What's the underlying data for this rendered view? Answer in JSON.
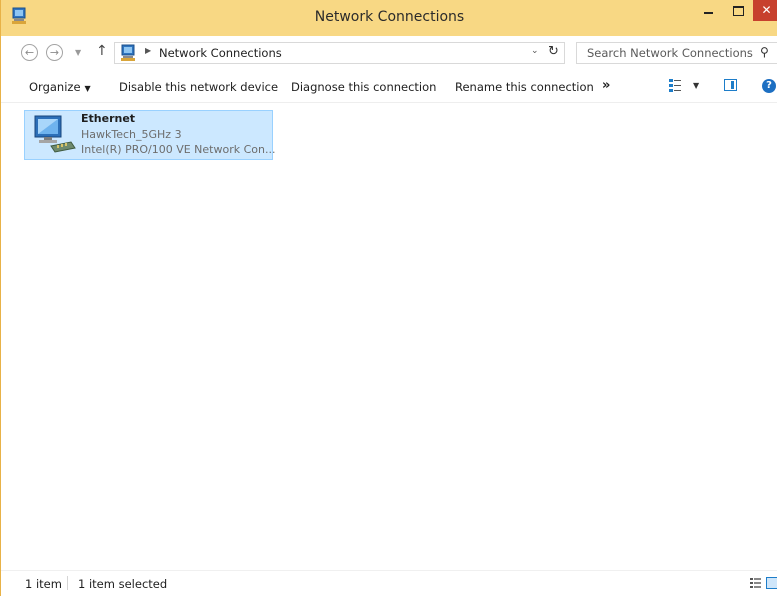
{
  "window": {
    "title": "Network Connections",
    "close_glyph": "✕",
    "accent_color": "#f8d884"
  },
  "address": {
    "path": "Network Connections",
    "search_placeholder": "Search Network Connections",
    "back_glyph": "←",
    "forward_glyph": "→",
    "recent_glyph": "▼",
    "up_glyph": "↑",
    "separator_glyph": "▶",
    "dropdown_glyph": "⌄",
    "refresh_glyph": "↻",
    "search_glyph": "⚲"
  },
  "toolbar": {
    "organize": "Organize",
    "organize_caret": "▼",
    "disable": "Disable this network device",
    "diagnose": "Diagnose this connection",
    "rename": "Rename this connection",
    "more": "»",
    "view_caret": "▼",
    "help": "?"
  },
  "connections": [
    {
      "name": "Ethernet",
      "network": "HawkTech_5GHz  3",
      "adapter": "Intel(R) PRO/100 VE Network Con...",
      "selected": true
    }
  ],
  "status": {
    "count": "1 item",
    "selected": "1 item selected"
  },
  "icons": {
    "title": "network-connections-icon",
    "path": "network-connections-icon",
    "item": "ethernet-adapter-icon"
  }
}
